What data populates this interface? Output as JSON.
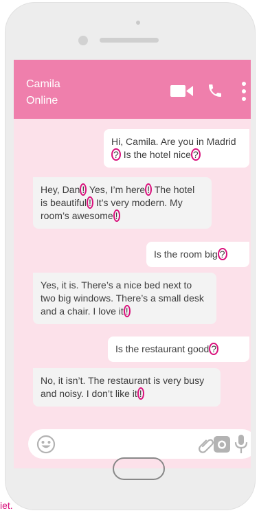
{
  "header": {
    "contact_name": "Camila",
    "status": "Online",
    "icons": [
      "video-call-icon",
      "phone-call-icon",
      "more-options-icon"
    ]
  },
  "messages": [
    {
      "direction": "outgoing",
      "text": "Hi, Camila. Are you in Madrid? Is the hotel nice?"
    },
    {
      "direction": "incoming",
      "text": "Hey, Dan! Yes, I’m here! The hotel is beautiful! It’s very modern. My room’s awesome!"
    },
    {
      "direction": "outgoing",
      "text": "Is the room big?"
    },
    {
      "direction": "incoming",
      "text": "Yes, it is. There’s a nice bed next to two big windows. There’s a small desk and a chair. I love it!"
    },
    {
      "direction": "outgoing",
      "text": "Is the restaurant good?"
    },
    {
      "direction": "incoming",
      "text": "No, it isn’t. The restaurant is very busy and noisy. I don’t like it!"
    }
  ],
  "input_bar": {
    "icons": [
      "emoji-icon",
      "attachment-icon",
      "camera-icon",
      "microphone-icon"
    ]
  },
  "edge_caption": "iet.",
  "colors": {
    "header": "#ef7fac",
    "screen_background": "#fce1ea",
    "outgoing_bubble": "#ffffff",
    "incoming_bubble": "#f3f3f3",
    "punctuation_highlight": "#d9117c",
    "icons": "#b3b3b3"
  }
}
